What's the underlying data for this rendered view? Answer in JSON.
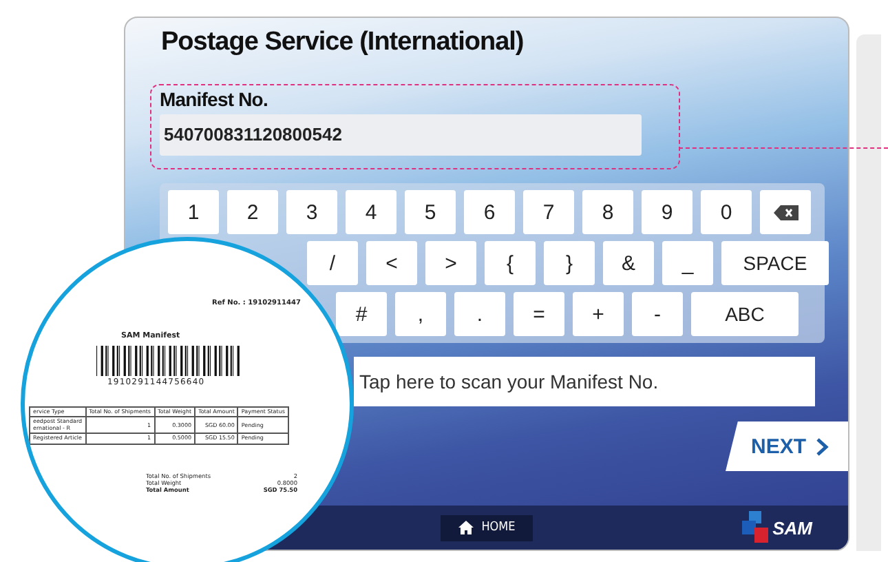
{
  "title": "Postage Service (International)",
  "manifest_field": {
    "label": "Manifest No.",
    "value": "540700831120800542"
  },
  "keyboard": {
    "rows": [
      {
        "keys": [
          {
            "label": "1",
            "kind": "char"
          },
          {
            "label": "2",
            "kind": "char"
          },
          {
            "label": "3",
            "kind": "char"
          },
          {
            "label": "4",
            "kind": "char"
          },
          {
            "label": "5",
            "kind": "char"
          },
          {
            "label": "6",
            "kind": "char"
          },
          {
            "label": "7",
            "kind": "char"
          },
          {
            "label": "8",
            "kind": "char"
          },
          {
            "label": "9",
            "kind": "char"
          },
          {
            "label": "0",
            "kind": "char"
          },
          {
            "kind": "backspace"
          }
        ]
      },
      {
        "keys": [
          {
            "label": "/",
            "kind": "char"
          },
          {
            "label": "<",
            "kind": "char"
          },
          {
            "label": ">",
            "kind": "char"
          },
          {
            "label": "{",
            "kind": "char"
          },
          {
            "label": "}",
            "kind": "char"
          },
          {
            "label": "&",
            "kind": "char"
          },
          {
            "label": "_",
            "kind": "char"
          },
          {
            "label": "SPACE",
            "kind": "wide"
          }
        ]
      },
      {
        "keys": [
          {
            "label": "#",
            "kind": "char"
          },
          {
            "label": ",",
            "kind": "char"
          },
          {
            "label": ".",
            "kind": "char"
          },
          {
            "label": "=",
            "kind": "char"
          },
          {
            "label": "+",
            "kind": "char"
          },
          {
            "label": "-",
            "kind": "char"
          },
          {
            "label": "ABC",
            "kind": "wide"
          }
        ]
      }
    ]
  },
  "scan_prompt": "Tap here to scan your Manifest No.",
  "next_button": "NEXT",
  "home_button": "HOME",
  "logo": "SAM",
  "receipt": {
    "ref": "Ref No. : 19102911447",
    "title": "SAM Manifest",
    "barcode_number": "1910291144756640",
    "columns": [
      "ervice Type",
      "Total No. of Shipments",
      "Total Weight",
      "Total Amount",
      "Payment Status"
    ],
    "rows": [
      [
        "eedpost Standard\nernational - R",
        "1",
        "0.3000",
        "SGD 60.00",
        "Pending"
      ],
      [
        "Registered Article",
        "1",
        "0.5000",
        "SGD 15.50",
        "Pending"
      ]
    ],
    "totals": [
      {
        "label": "Total No. of Shipments",
        "value": "2",
        "bold": false
      },
      {
        "label": "Total Weight",
        "value": "0.8000",
        "bold": false
      },
      {
        "label": "Total Amount",
        "value": "SGD 75.50",
        "bold": true
      }
    ]
  }
}
